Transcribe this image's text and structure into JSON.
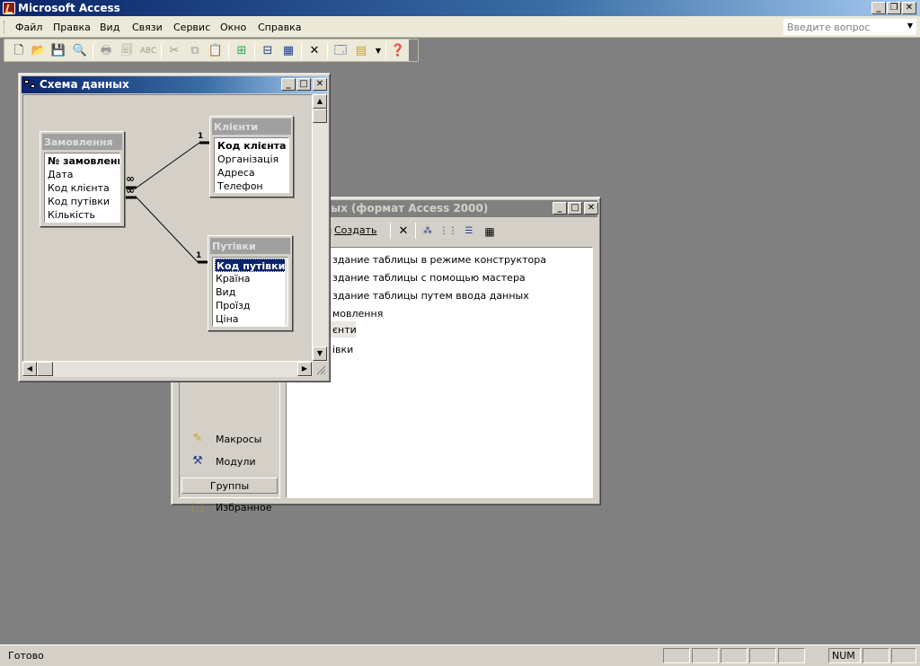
{
  "app": {
    "title": "Microsoft Access"
  },
  "menu": {
    "items": [
      "Файл",
      "Правка",
      "Вид",
      "Связи",
      "Сервис",
      "Окно",
      "Справка"
    ],
    "ask_placeholder": "Введите вопрос"
  },
  "toolbar": {
    "icons": [
      "new-file-icon",
      "open-folder-icon",
      "save-icon",
      "print-preview-icon",
      "print-icon",
      "preview-icon",
      "spelling-icon",
      "cut-icon",
      "copy-icon",
      "paste-icon",
      "show-table-icon",
      "show-direct-icon",
      "show-all-icon",
      "delete-icon",
      "database-window-icon",
      "new-object-icon",
      "help-icon"
    ]
  },
  "db_window": {
    "title": "ных (формат Access 2000)",
    "create_label": "Создать",
    "items": [
      "здание таблицы в режиме конструктора",
      "здание таблицы с помощью мастера",
      "здание таблицы путем ввода данных",
      "мовлення",
      "єнти",
      "івки"
    ],
    "selected_index": 4,
    "groups_panel": {
      "objects": [
        {
          "label": "Макросы",
          "icon": "macro-icon"
        },
        {
          "label": "Модули",
          "icon": "module-icon"
        }
      ],
      "groups_header": "Группы",
      "favorites": {
        "label": "Избранное",
        "icon": "favorites-folder-icon"
      }
    }
  },
  "relationships": {
    "title": "Схема данных",
    "tables": [
      {
        "name": "Замовлення",
        "fields": [
          "№ замовлення",
          "Дата",
          "Код клієнта",
          "Код путівки",
          "Кількість"
        ],
        "primary_key": "№ замовлення"
      },
      {
        "name": "Клієнти",
        "fields": [
          "Код клієнта",
          "Організація",
          "Адреса",
          "Телефон"
        ],
        "primary_key": "Код клієнта"
      },
      {
        "name": "Путівки",
        "fields": [
          "Код путівки",
          "Країна",
          "Вид",
          "Проїзд",
          "Ціна"
        ],
        "primary_key": "Код путівки",
        "selected_field": "Код путівки"
      }
    ],
    "links": [
      {
        "many_label": "∞",
        "one_label": "1"
      },
      {
        "many_label": "∞",
        "one_label": "1"
      }
    ]
  },
  "status": {
    "text": "Готово",
    "num": "NUM"
  }
}
